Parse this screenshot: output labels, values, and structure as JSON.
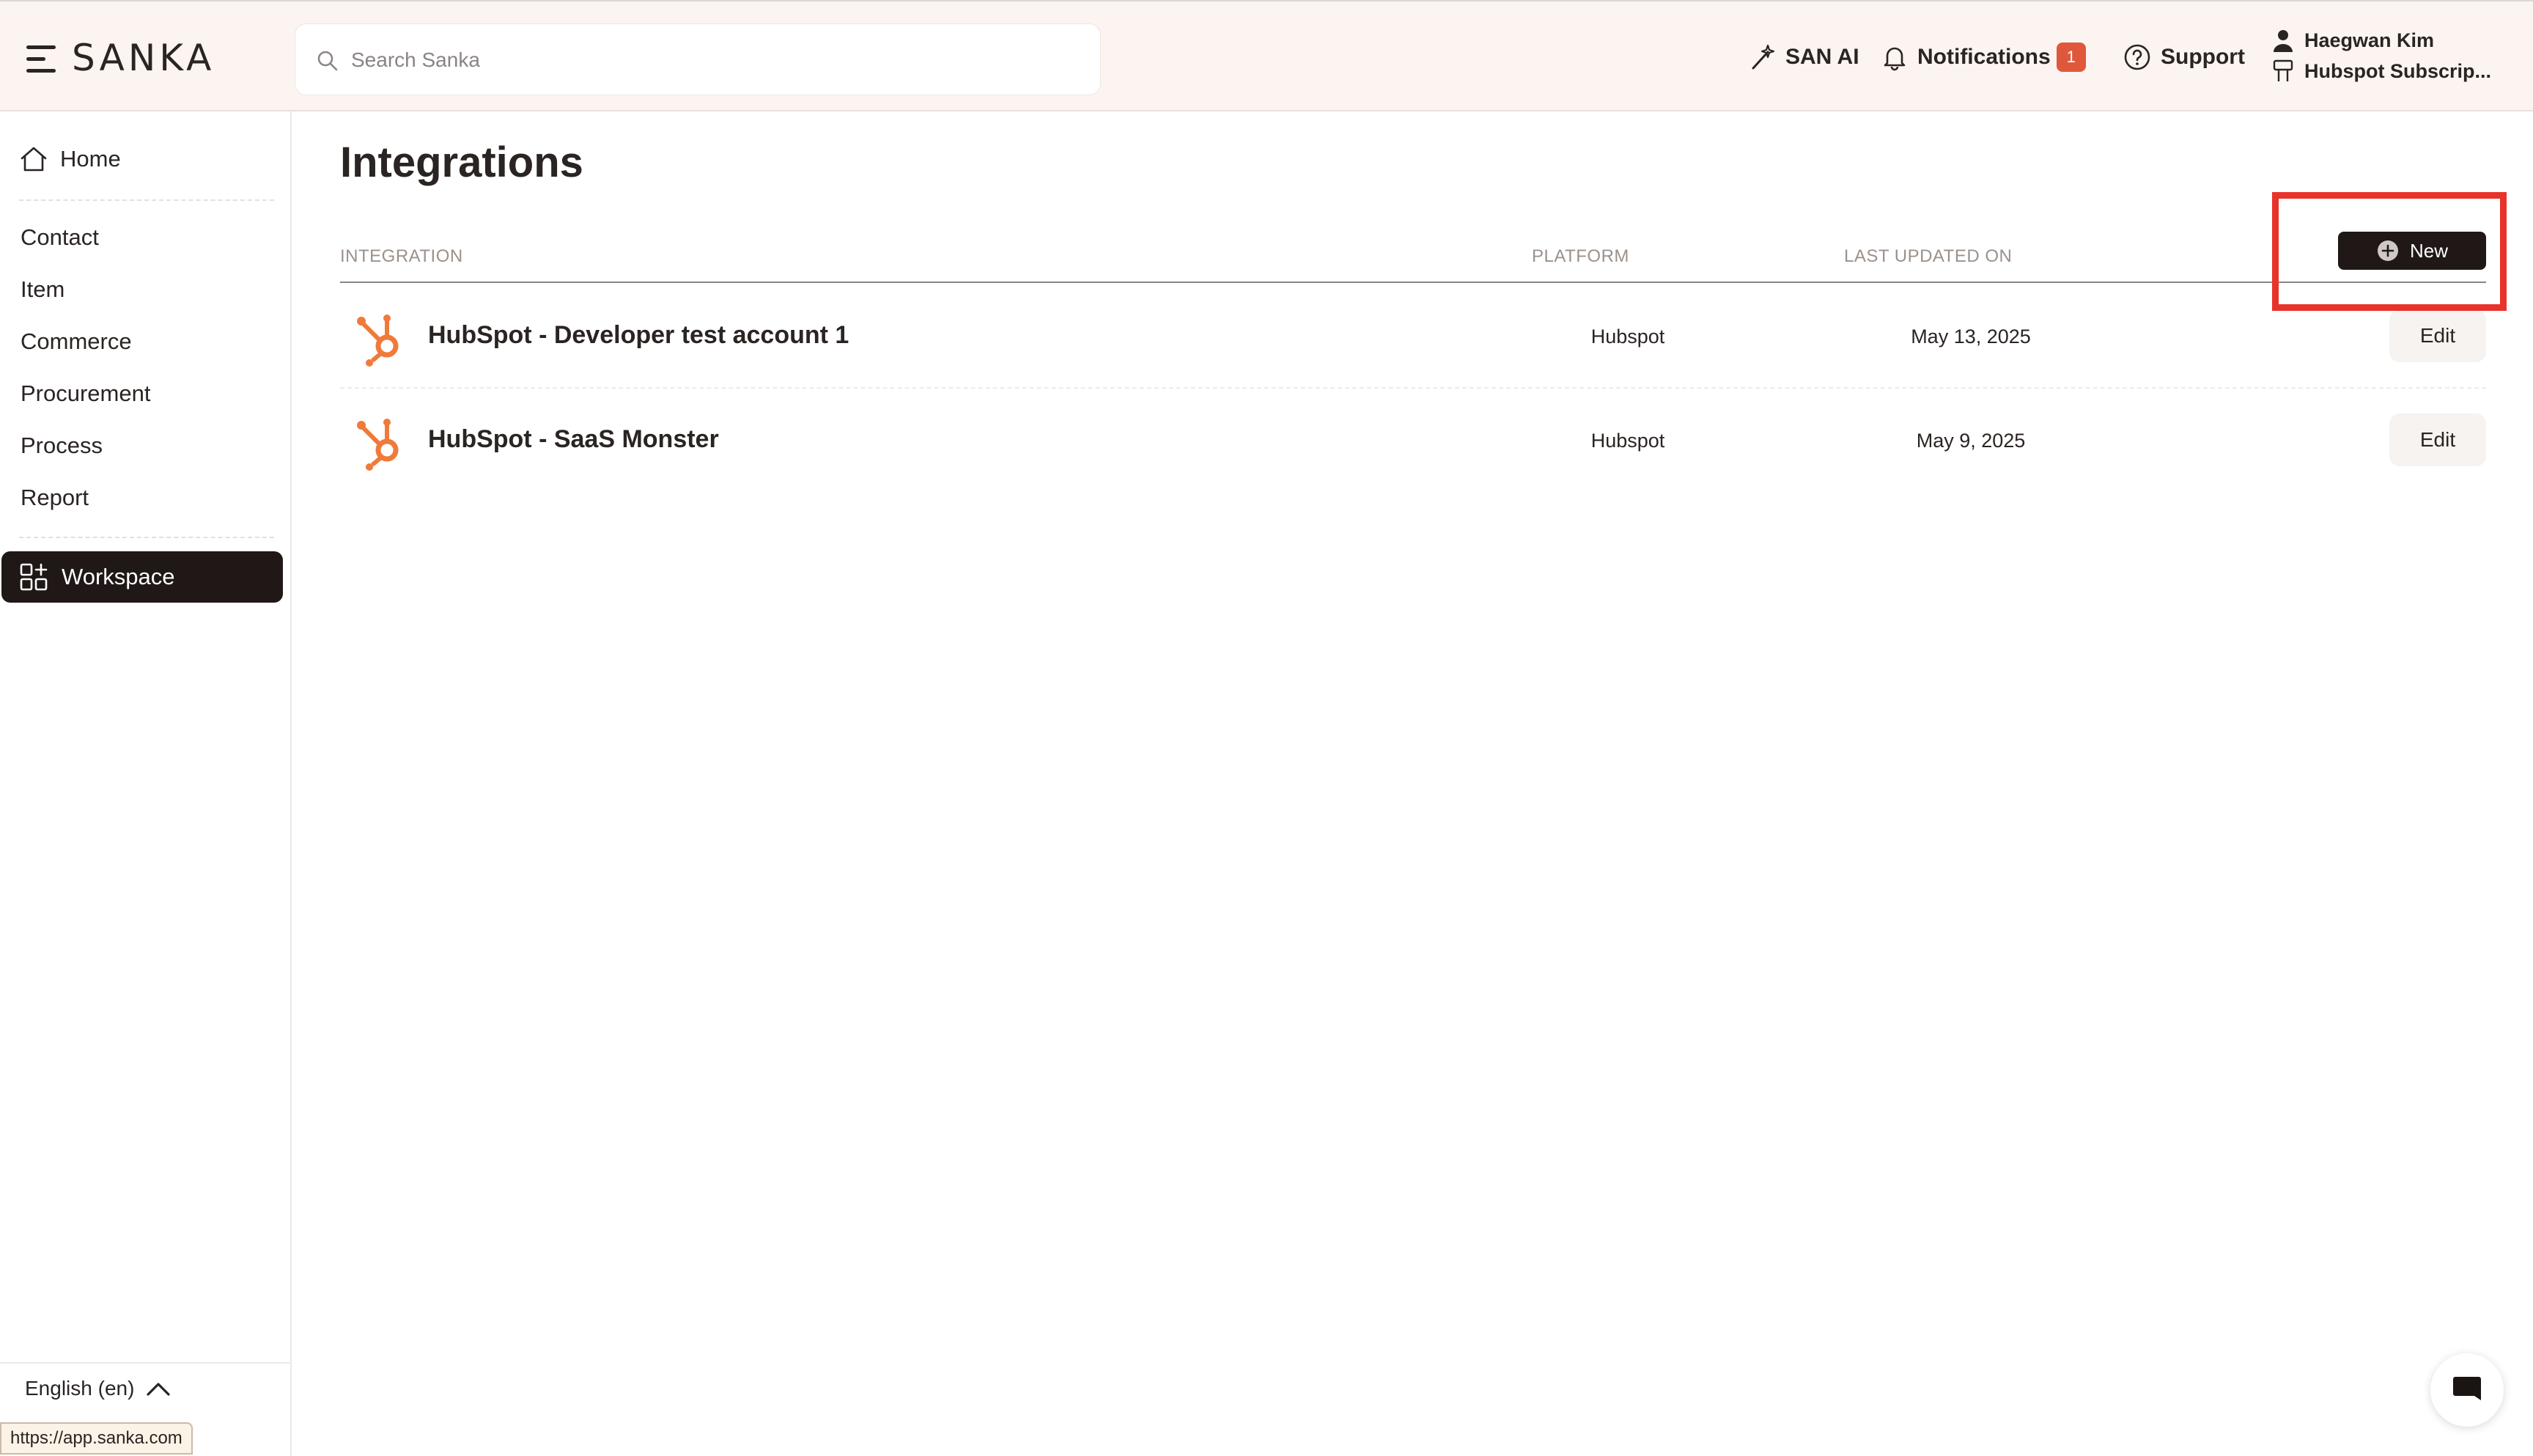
{
  "app": {
    "brand": "SANKA",
    "url_tooltip": "https://app.sanka.com"
  },
  "header": {
    "search_placeholder": "Search Sanka",
    "san_ai_label": "SAN AI",
    "notifications_label": "Notifications",
    "notifications_count": "1",
    "support_label": "Support",
    "user_name": "Haegwan Kim",
    "workspace_name": "Hubspot Subscrip..."
  },
  "sidebar": {
    "home_label": "Home",
    "items": [
      {
        "label": "Contact"
      },
      {
        "label": "Item"
      },
      {
        "label": "Commerce"
      },
      {
        "label": "Procurement"
      },
      {
        "label": "Process"
      },
      {
        "label": "Report"
      }
    ],
    "active_label": "Workspace",
    "language_label": "English (en)"
  },
  "main": {
    "title": "Integrations",
    "new_button_label": "New",
    "columns": {
      "integration": "INTEGRATION",
      "platform": "PLATFORM",
      "last_updated": "LAST UPDATED ON"
    },
    "rows": [
      {
        "name": "HubSpot - Developer test account 1",
        "platform": "Hubspot",
        "updated": "May 13, 2025",
        "action": "Edit"
      },
      {
        "name": "HubSpot - SaaS Monster",
        "platform": "Hubspot",
        "updated": "May 9, 2025",
        "action": "Edit"
      }
    ]
  },
  "colors": {
    "topbar_bg": "#fcf4f0",
    "dark": "#1f1816",
    "badge": "#e0583c",
    "hubspot_orange": "#ef7a3a",
    "highlight": "#e8332a"
  }
}
